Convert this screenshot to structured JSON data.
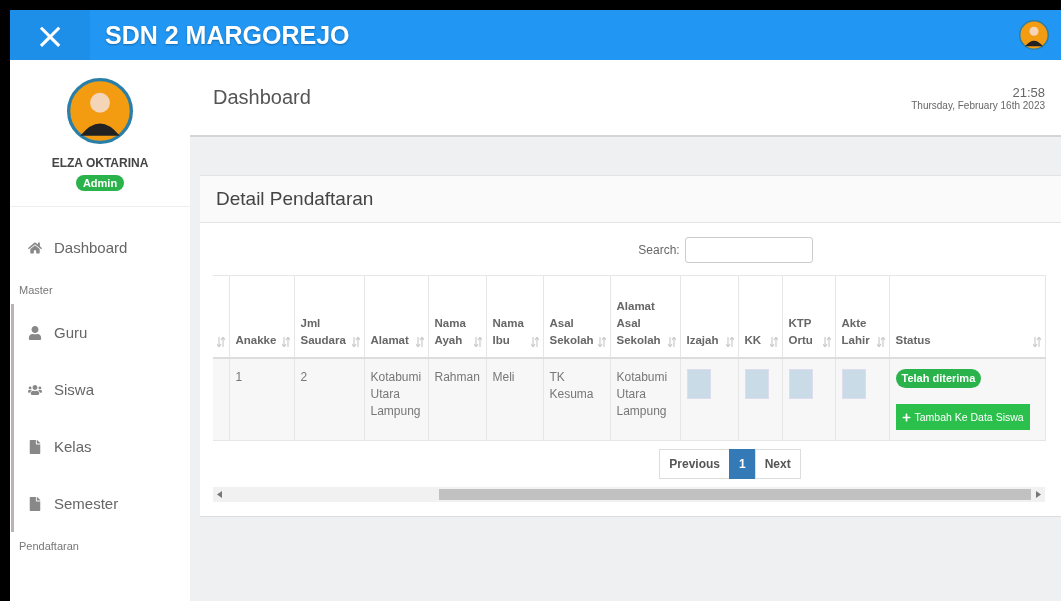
{
  "header": {
    "title": "SDN 2 MARGOREJO",
    "close": "×"
  },
  "sidebar": {
    "user": {
      "name": "ELZA OKTARINA",
      "role": "Admin"
    },
    "groups": [
      {
        "items": [
          {
            "label": "Dashboard"
          }
        ]
      },
      {
        "title": "Master",
        "items": [
          {
            "label": "Guru"
          },
          {
            "label": "Siswa"
          },
          {
            "label": "Kelas"
          },
          {
            "label": "Semester"
          }
        ]
      },
      {
        "title": "Pendaftaran"
      }
    ]
  },
  "page": {
    "title": "Dashboard",
    "time": "21:58",
    "date": "Thursday, February 16th 2023"
  },
  "card": {
    "title": "Detail Pendaftaran",
    "search": {
      "label": "Search:"
    },
    "table": {
      "columns": [
        "Anakke",
        "Jml Saudara",
        "Alamat",
        "Nama Ayah",
        "Nama Ibu",
        "Asal Sekolah",
        "Alamat Asal Sekolah",
        "Izajah",
        "KK",
        "KTP Ortu",
        "Akte Lahir",
        "Status"
      ],
      "rows": [
        {
          "cells": [
            {
              "kind": "text",
              "text": "1"
            },
            {
              "kind": "text",
              "text": "2"
            },
            {
              "kind": "text",
              "text": "Kotabumi Utara Lampung"
            },
            {
              "kind": "text",
              "text": "Rahman"
            },
            {
              "kind": "text",
              "text": "Meli"
            },
            {
              "kind": "text",
              "text": "TK Kesuma"
            },
            {
              "kind": "text",
              "text": "Kotabumi Utara Lampung"
            },
            {
              "kind": "image"
            },
            {
              "kind": "image"
            },
            {
              "kind": "image"
            },
            {
              "kind": "image"
            },
            {
              "kind": "status",
              "badge": "Telah diterima",
              "action": "Tambah Ke Data Siswa"
            }
          ]
        }
      ]
    },
    "pagination": [
      {
        "label": "Previous",
        "selected": false
      },
      {
        "label": "1",
        "selected": true
      },
      {
        "label": "Next",
        "selected": false
      }
    ]
  }
}
